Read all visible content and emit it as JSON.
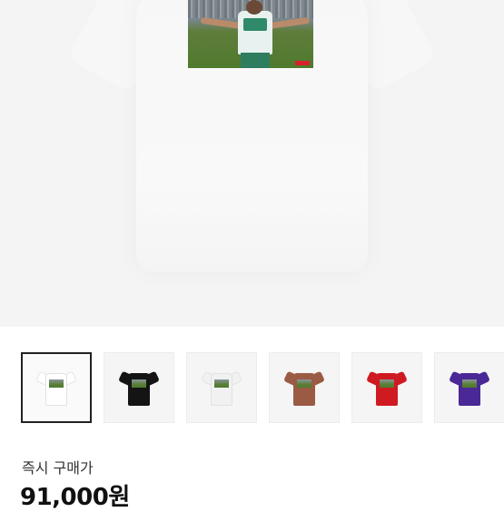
{
  "product": {
    "main_image": "white-tee-photo-print",
    "purchase_label": "즉시 구매가",
    "price": "91,000원"
  },
  "thumbnails": [
    {
      "name": "white",
      "color": "#ffffff",
      "selected": true
    },
    {
      "name": "black",
      "color": "#141414",
      "selected": false
    },
    {
      "name": "white-grey",
      "color": "#f1f1f1",
      "selected": false
    },
    {
      "name": "brown",
      "color": "#9b5a43",
      "selected": false
    },
    {
      "name": "red",
      "color": "#d01a21",
      "selected": false
    },
    {
      "name": "purple",
      "color": "#4a2896",
      "selected": false
    }
  ]
}
